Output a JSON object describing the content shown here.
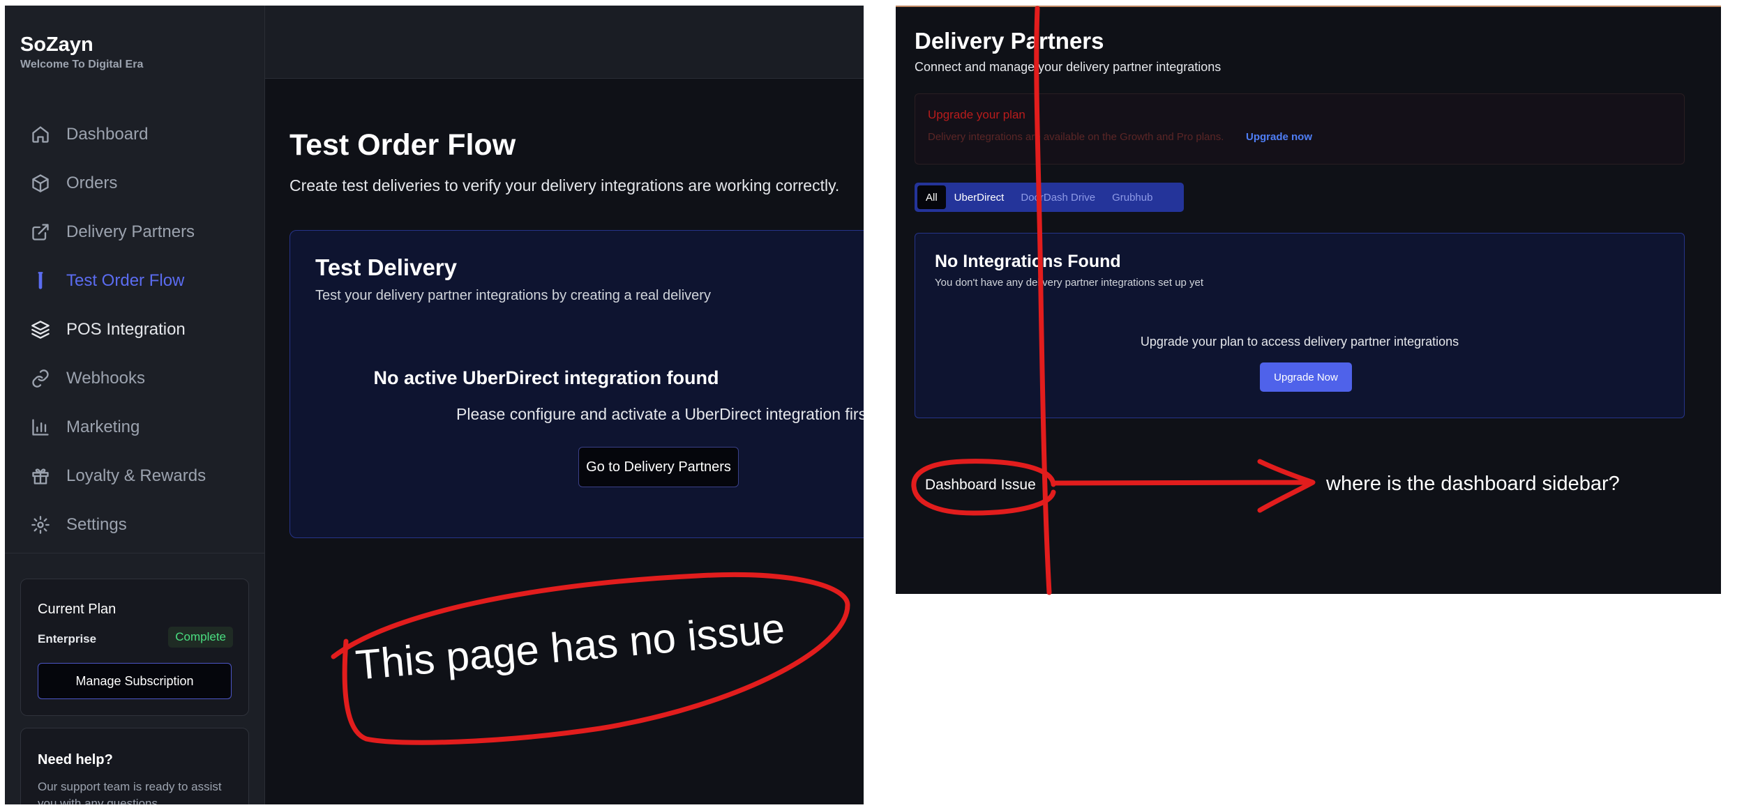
{
  "sidebar": {
    "brand": "SoZayn",
    "tagline": "Welcome To Digital Era",
    "items": [
      {
        "label": "Dashboard",
        "icon": "home-icon"
      },
      {
        "label": "Orders",
        "icon": "box-icon"
      },
      {
        "label": "Delivery Partners",
        "icon": "external-link-icon"
      },
      {
        "label": "Test Order Flow",
        "icon": "test-tube-icon",
        "active": true
      },
      {
        "label": "POS Integration",
        "icon": "layers-icon"
      },
      {
        "label": "Webhooks",
        "icon": "link-icon"
      },
      {
        "label": "Marketing",
        "icon": "bar-chart-icon"
      },
      {
        "label": "Loyalty & Rewards",
        "icon": "gift-icon"
      },
      {
        "label": "Settings",
        "icon": "gear-icon"
      }
    ],
    "plan": {
      "title": "Current Plan",
      "name": "Enterprise",
      "status": "Complete",
      "manage_label": "Manage Subscription"
    },
    "help": {
      "title": "Need help?",
      "text": "Our support team is ready to assist you with any questions"
    }
  },
  "test_page": {
    "title": "Test Order Flow",
    "subtitle": "Create test deliveries to verify your delivery integrations are working correctly.",
    "card": {
      "title": "Test Delivery",
      "subtitle": "Test your delivery partner integrations by creating a real delivery",
      "heading": "No active UberDirect integration found",
      "message": "Please configure and activate a UberDirect integration first",
      "button": "Go to Delivery Partners"
    }
  },
  "partners_page": {
    "title": "Delivery Partners",
    "subtitle": "Connect and manage your delivery partner integrations",
    "upgrade": {
      "title": "Upgrade your plan",
      "text": "Delivery integrations are available on the Growth and Pro plans.",
      "link": "Upgrade now"
    },
    "tabs": [
      "All",
      "UberDirect",
      "DoorDash Drive",
      "Grubhub"
    ],
    "empty": {
      "title": "No Integrations Found",
      "subtitle": "You don't have any delivery partner integrations set up yet",
      "message": "Upgrade your plan to access delivery partner integrations",
      "button": "Upgrade Now"
    }
  },
  "annotations": {
    "no_issue": "This page has no issue",
    "issue_label": "Dashboard Issue",
    "question": "where is the dashboard sidebar?"
  },
  "colors": {
    "accent": "#5b6cf0",
    "annotation_red": "#e21d1d",
    "success": "#4ade80",
    "warning_red": "#b91c1c"
  }
}
